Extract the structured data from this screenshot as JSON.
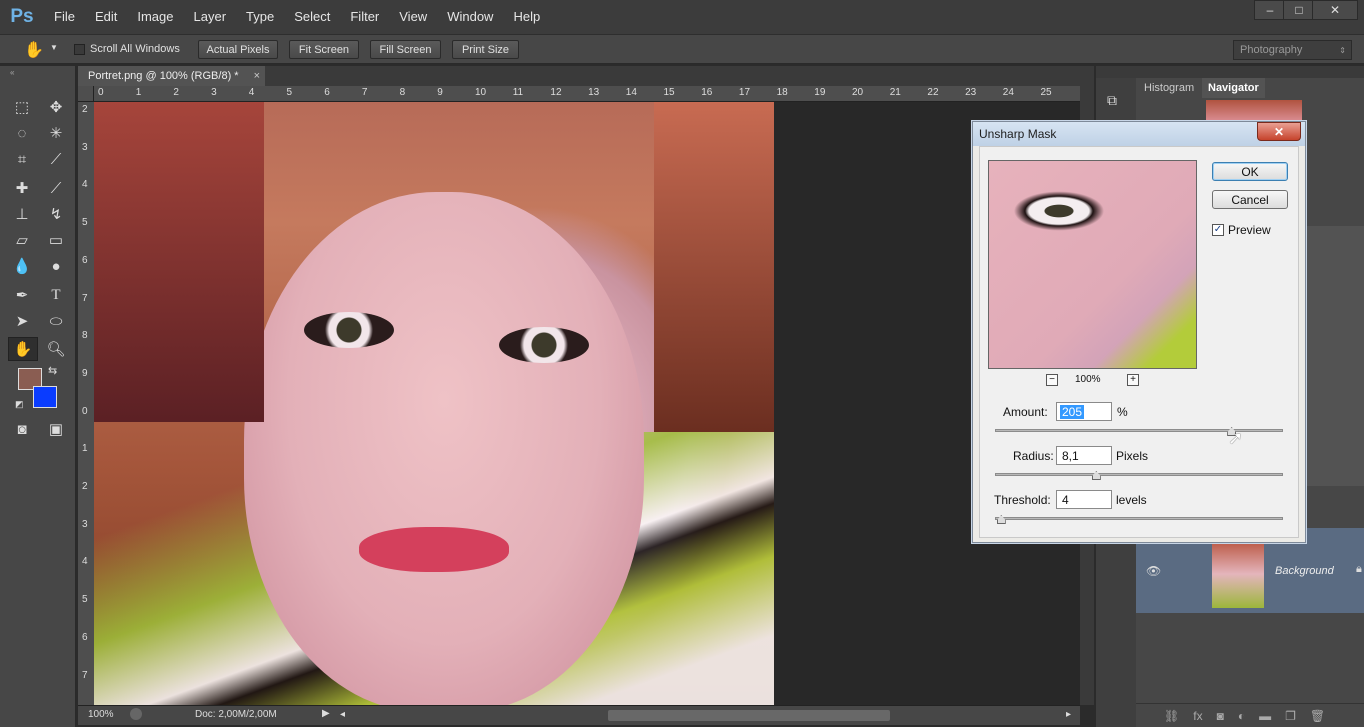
{
  "app": {
    "logo": "Ps"
  },
  "menu": [
    "File",
    "Edit",
    "Image",
    "Layer",
    "Type",
    "Select",
    "Filter",
    "View",
    "Window",
    "Help"
  ],
  "window_buttons": {
    "minimize": "–",
    "maximize": "□",
    "close": "✕"
  },
  "options": {
    "scroll_all_label": "Scroll All Windows",
    "actual_pixels": "Actual Pixels",
    "fit_screen": "Fit Screen",
    "fill_screen": "Fill Screen",
    "print_size": "Print Size",
    "workspace": "Photography"
  },
  "document": {
    "tab_title": "Portret.png @ 100% (RGB/8) *",
    "tab_close": "×",
    "ruler_top": [
      "0",
      "1",
      "2",
      "3",
      "4",
      "5",
      "6",
      "7",
      "8",
      "9",
      "10",
      "11",
      "12",
      "13",
      "14",
      "15",
      "16",
      "17",
      "18",
      "19",
      "20",
      "21",
      "22",
      "23",
      "24",
      "25"
    ],
    "ruler_left": [
      "2",
      "3",
      "4",
      "5",
      "6",
      "7",
      "8",
      "9",
      "0",
      "1",
      "2",
      "3",
      "4",
      "5",
      "6",
      "7"
    ],
    "zoom": "100%",
    "doc_info": "Doc: 2,00M/2,00M"
  },
  "panels": {
    "tab_histogram": "Histogram",
    "tab_navigator": "Navigator",
    "layer_name": "Background"
  },
  "dialog": {
    "title": "Unsharp Mask",
    "ok": "OK",
    "cancel": "Cancel",
    "preview_label": "Preview",
    "preview_checked": true,
    "zoom_label": "100%",
    "amount_label": "Amount:",
    "amount_value": "205",
    "amount_unit": "%",
    "amount_slider_fraction": 0.82,
    "radius_label": "Radius:",
    "radius_value": "8,1",
    "radius_unit": "Pixels",
    "radius_slider_fraction": 0.35,
    "threshold_label": "Threshold:",
    "threshold_value": "4",
    "threshold_unit": "levels",
    "threshold_slider_fraction": 0.02
  }
}
